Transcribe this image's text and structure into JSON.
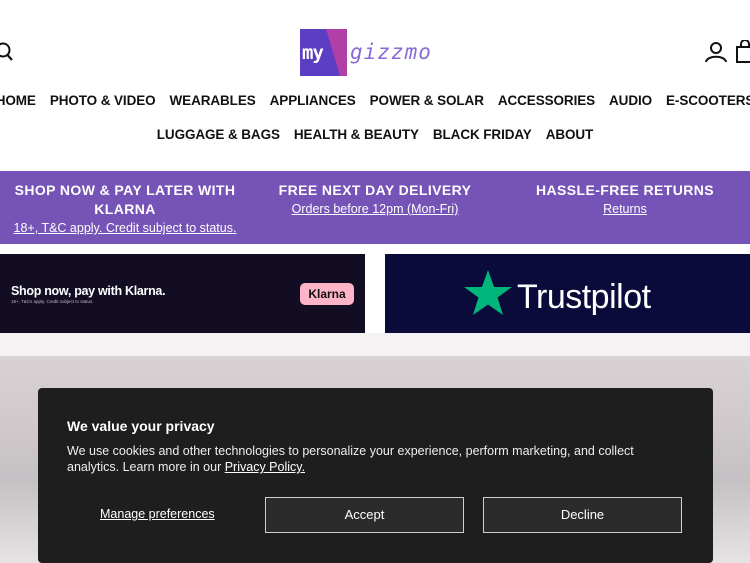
{
  "header": {
    "logo_box_text": "my",
    "logo_text": "gizzmo"
  },
  "nav": {
    "row1": [
      "HOME",
      "PHOTO & VIDEO",
      "WEARABLES",
      "APPLIANCES",
      "POWER & SOLAR",
      "ACCESSORIES",
      "AUDIO",
      "E-SCOOTERS"
    ],
    "row2": [
      "LUGGAGE & BAGS",
      "HEALTH & BEAUTY",
      "BLACK FRIDAY",
      "ABOUT"
    ]
  },
  "info": {
    "klarna_title": "SHOP NOW & PAY LATER WITH KLARNA",
    "klarna_sub": "18+, T&C apply. Credit subject to status.",
    "delivery_title": "FREE NEXT DAY DELIVERY",
    "delivery_sub": "Orders before 12pm (Mon-Fri)",
    "returns_title": "HASSLE-FREE RETURNS",
    "returns_sub": "Returns"
  },
  "banners": {
    "klarna_heading": "Shop now, pay with Klarna.",
    "klarna_small": "18+, T&Cs apply. Credit subject to status.",
    "klarna_badge": "Klarna",
    "trustpilot": "Trustpilot"
  },
  "cookie": {
    "title": "We value your privacy",
    "body": "We use cookies and other technologies to personalize your experience, perform marketing, and collect analytics. Learn more in our ",
    "link": "Privacy Policy.",
    "manage": "Manage preferences",
    "accept": "Accept",
    "decline": "Decline"
  },
  "colors": {
    "brand_purple": "#7653b6",
    "trustpilot_green": "#00b67a",
    "klarna_pink": "#ffb3c7"
  }
}
